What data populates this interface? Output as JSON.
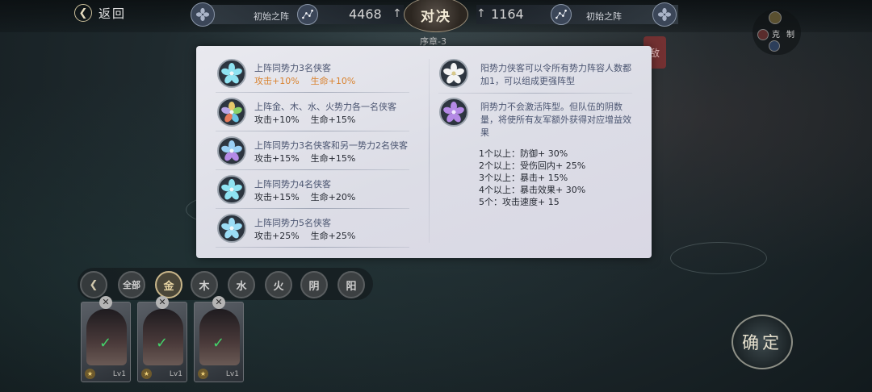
{
  "header": {
    "back_label": "返回",
    "left_formation": "初始之阵",
    "left_power": "4468",
    "vs_label": "对决",
    "right_power": "1164",
    "right_formation": "初始之阵",
    "round_label": "序章-3"
  },
  "top_right": {
    "label_a": "克",
    "label_b": "制"
  },
  "modal": {
    "bonds": [
      {
        "title": "上阵同势力3名侠客",
        "attack": "攻击+10%",
        "hp": "生命+10%",
        "active": true,
        "flower": "flower-icon-blue",
        "color": "#8fe3f2"
      },
      {
        "title": "上阵金、木、水、火势力各一名侠客",
        "attack": "攻击+10%",
        "hp": "生命+15%",
        "active": false,
        "flower": "flower-icon-multicolor",
        "color": "#e6c86a"
      },
      {
        "title": "上阵同势力3名侠客和另一势力2名侠客",
        "attack": "攻击+15%",
        "hp": "生命+15%",
        "active": false,
        "flower": "flower-icon-blue-purple",
        "color": "#9bd0f5"
      },
      {
        "title": "上阵同势力4名侠客",
        "attack": "攻击+15%",
        "hp": "生命+20%",
        "active": false,
        "flower": "flower-icon-cyan",
        "color": "#8fe3f2"
      },
      {
        "title": "上阵同势力5名侠客",
        "attack": "攻击+25%",
        "hp": "生命+25%",
        "active": false,
        "flower": "flower-icon-light-blue",
        "color": "#9bdcf5"
      }
    ],
    "yang_text": "阳势力侠客可以令所有势力阵容人数都加1，可以组成更强阵型",
    "yin_text": "阴势力不会激活阵型。但队伍的阴数量，将使所有友军额外获得对应增益效果",
    "yin_effects": [
      "1个以上：防御+ 30%",
      "2个以上：受伤回内+ 25%",
      "3个以上：暴击+ 15%",
      "4个以上：暴击效果+ 30%",
      "5个：攻击速度+ 15"
    ],
    "yang_color": "#ffffff",
    "yin_color": "#b58ae6"
  },
  "filters": [
    {
      "label": "全部",
      "active": false
    },
    {
      "label": "金",
      "active": true
    },
    {
      "label": "木",
      "active": false
    },
    {
      "label": "水",
      "active": false
    },
    {
      "label": "火",
      "active": false
    },
    {
      "label": "阴",
      "active": false
    },
    {
      "label": "阳",
      "active": false
    }
  ],
  "cards": [
    {
      "level": "Lv1"
    },
    {
      "level": "Lv1"
    },
    {
      "level": "Lv1"
    }
  ],
  "confirm_label": "确定",
  "banner_text": "敌"
}
